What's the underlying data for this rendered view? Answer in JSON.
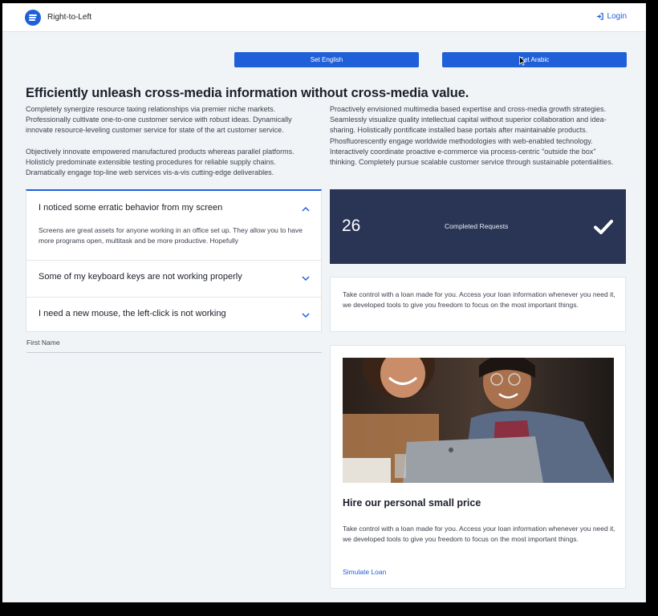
{
  "header": {
    "brand": "Right-to-Left",
    "login_label": "Login"
  },
  "toolbar": {
    "set_english_label": "Set English",
    "set_arabic_label": "Set Arabic"
  },
  "main": {
    "title": "Efficiently unleash cross-media information without cross-media value.",
    "col1_p1": "Completely synergize resource taxing relationships via premier niche markets. Professionally cultivate one-to-one customer service with robust ideas. Dynamically innovate resource-leveling customer service for state of the art customer service.",
    "col1_p2": "Objectively innovate empowered manufactured products whereas parallel platforms. Holisticly predominate extensible testing procedures for reliable supply chains. Dramatically engage top-line web services vis-a-vis cutting-edge deliverables.",
    "col2_p1": "Proactively envisioned multimedia based expertise and cross-media growth strategies. Seamlessly visualize quality intellectual capital without superior collaboration and idea-sharing. Holistically pontificate installed base portals after maintainable products. Phosfluorescently engage worldwide methodologies with web-enabled technology. Interactively coordinate proactive e-commerce via process-centric \"outside the box\" thinking. Completely pursue scalable customer service through sustainable potentialities."
  },
  "accordion": {
    "items": [
      {
        "title": "I noticed some erratic behavior from my screen",
        "body": "Screens are great assets for anyone working in an office set up. They allow you to have more programs open, multitask and be more productive. Hopefully",
        "expanded": true
      },
      {
        "title": "Some of my keyboard keys are not working properly",
        "expanded": false
      },
      {
        "title": "I need a new mouse, the left-click is not working",
        "expanded": false
      }
    ]
  },
  "form": {
    "first_name_label": "First Name"
  },
  "stat": {
    "number": "26",
    "label": "Completed Requests"
  },
  "card": {
    "text": "Take control with a loan made for you. Access your loan information whenever you need it, we developed tools to give you freedom to focus on the most important things."
  },
  "card2": {
    "title": "Hire our personal small price",
    "text": "Take control with a loan made for you. Access your loan information whenever you need it, we developed tools to give you freedom to focus on the most important things.",
    "link_label": "Simulate Loan"
  },
  "colors": {
    "accent": "#1f5fd8",
    "stat_bg": "#2a3555",
    "page_bg": "#f1f4f7"
  }
}
